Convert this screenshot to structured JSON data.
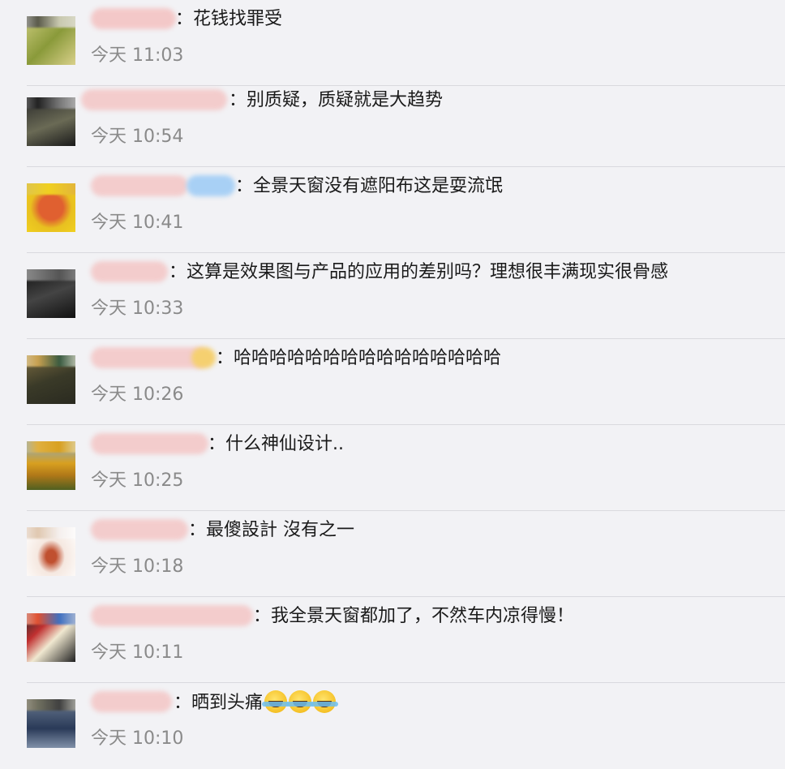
{
  "comments": [
    {
      "text": "：花钱找罪受",
      "time": "今天 11:03"
    },
    {
      "text": "：别质疑，质疑就是大趋势",
      "time": "今天 10:54"
    },
    {
      "text": "：全景天窗没有遮阳布这是耍流氓",
      "time": "今天 10:41"
    },
    {
      "text": "：这算是效果图与产品的应用的差别吗？理想很丰满现实很骨感",
      "time": "今天 10:33"
    },
    {
      "text": "：哈哈哈哈哈哈哈哈哈哈哈哈哈哈哈",
      "time": "今天 10:26"
    },
    {
      "text": "：什么神仙设计..",
      "time": "今天 10:25"
    },
    {
      "text": "：最傻設計 沒有之一",
      "time": "今天 10:18"
    },
    {
      "text": "：我全景天窗都加了，不然车内凉得慢！",
      "time": "今天 10:11"
    },
    {
      "text": "：晒到头痛",
      "time": "今天 10:10",
      "emoji": [
        "laughing-crying-emoji",
        "laughing-crying-emoji",
        "laughing-crying-emoji"
      ]
    }
  ],
  "colors": {
    "background": "#f2f2f5",
    "username": "#e0806a",
    "comment_text": "#1a1a1a",
    "timestamp": "#8a8a8a",
    "divider": "#d9d9de"
  }
}
